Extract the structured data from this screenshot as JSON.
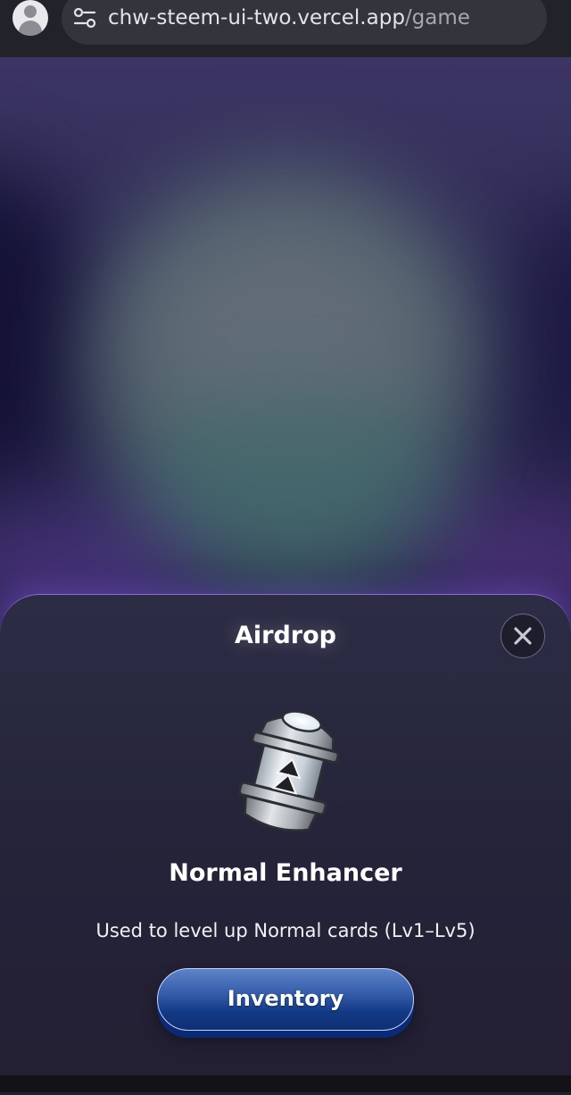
{
  "browser": {
    "url_host": "chw-steem-ui-two.vercel.app",
    "url_path": "/game"
  },
  "modal": {
    "title": "Airdrop",
    "item_name": "Normal Enhancer",
    "item_description": "Used to level up Normal cards (Lv1–Lv5)",
    "primary_button_label": "Inventory",
    "close_icon": "close-icon"
  },
  "colors": {
    "modal_border": "#8a6fd6",
    "button_blue": "#133a85"
  }
}
